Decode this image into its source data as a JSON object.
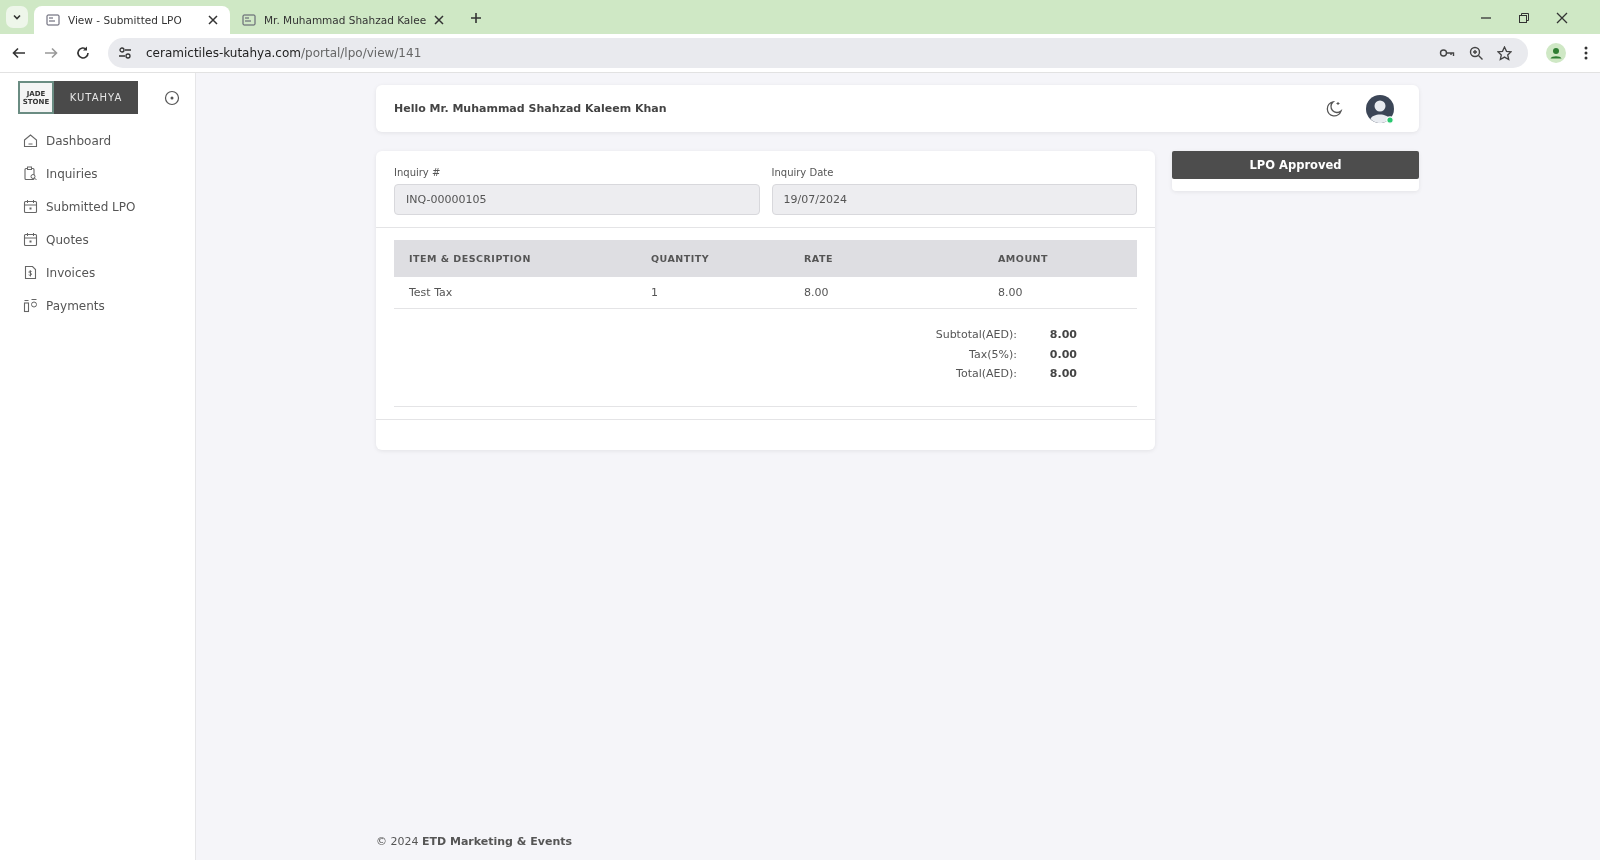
{
  "browser": {
    "tabs": [
      {
        "title": "View - Submitted LPO",
        "selected": true
      },
      {
        "title": "Mr. Muhammad Shahzad Kalee",
        "selected": false
      }
    ],
    "url_host": "ceramictiles-kutahya.com",
    "url_path": "/portal/lpo/view/141"
  },
  "sidebar": {
    "logo": {
      "left": "JADE STONE",
      "right": "KUTAHYA"
    },
    "items": [
      {
        "label": "Dashboard",
        "kind": "home",
        "selected": false
      },
      {
        "label": "Inquiries",
        "kind": "search-doc",
        "selected": false
      },
      {
        "label": "Submitted LPO",
        "kind": "calendar",
        "selected": false
      },
      {
        "label": "Quotes",
        "kind": "calendar",
        "selected": false
      },
      {
        "label": "Invoices",
        "kind": "invoice",
        "selected": false
      },
      {
        "label": "Payments",
        "kind": "payments",
        "selected": false
      }
    ]
  },
  "header": {
    "greeting": "Hello Mr. Muhammad Shahzad Kaleem Khan"
  },
  "form": {
    "fields": [
      {
        "label": "Inquiry #",
        "value": "INQ-00000105"
      },
      {
        "label": "Inquiry Date",
        "value": "19/07/2024"
      }
    ]
  },
  "table": {
    "columns": [
      "ITEM & DESCRIPTION",
      "QUANTITY",
      "RATE",
      "AMOUNT"
    ],
    "rows": [
      [
        "Test Tax",
        "1",
        "8.00",
        "8.00"
      ]
    ]
  },
  "totals": [
    {
      "label": "Subtotal(AED):",
      "value": "8.00"
    },
    {
      "label": "Tax(5%):",
      "value": "0.00"
    },
    {
      "label": "Total(AED):",
      "value": "8.00"
    }
  ],
  "status": {
    "label": "LPO Approved"
  },
  "footer": "© 2024 **ETD Marketing & Events**"
}
